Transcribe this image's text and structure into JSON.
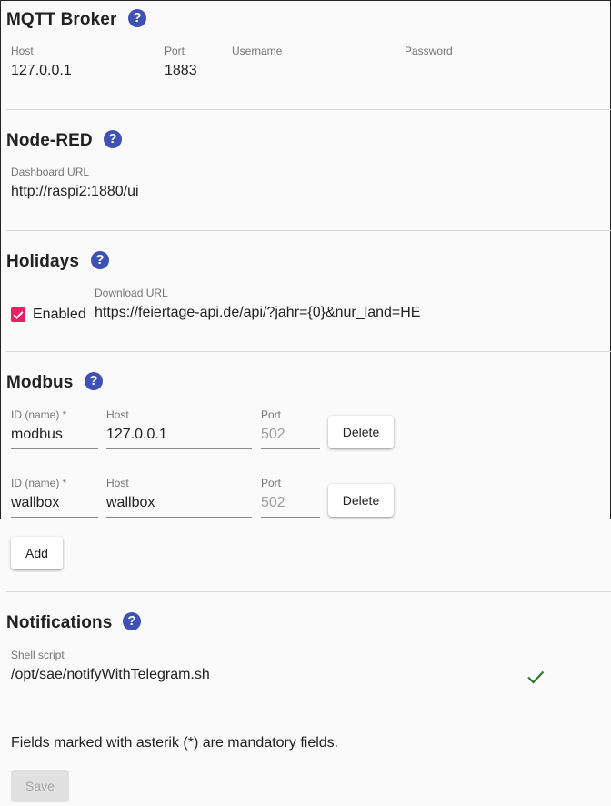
{
  "mqtt": {
    "title": "MQTT Broker",
    "host": {
      "label": "Host",
      "value": "127.0.0.1"
    },
    "port": {
      "label": "Port",
      "value": "1883"
    },
    "username": {
      "label": "Username",
      "value": ""
    },
    "password": {
      "label": "Password",
      "value": ""
    }
  },
  "nodered": {
    "title": "Node-RED",
    "dashboard_url": {
      "label": "Dashboard URL",
      "value": "http://raspi2:1880/ui"
    }
  },
  "holidays": {
    "title": "Holidays",
    "enabled_label": "Enabled",
    "enabled": true,
    "download_url": {
      "label": "Download URL",
      "value": "https://feiertage-api.de/api/?jahr={0}&nur_land=HE"
    }
  },
  "modbus": {
    "title": "Modbus",
    "id_label": "ID (name) *",
    "host_label": "Host",
    "port_label": "Port",
    "delete_label": "Delete",
    "add_label": "Add",
    "rows": [
      {
        "id": "modbus",
        "host": "127.0.0.1",
        "port": "502"
      },
      {
        "id": "wallbox",
        "host": "wallbox",
        "port": "502"
      }
    ]
  },
  "notifications": {
    "title": "Notifications",
    "shell_script": {
      "label": "Shell script",
      "value": "/opt/sae/notifyWithTelegram.sh"
    }
  },
  "footer": {
    "mandatory_note": "Fields marked with asterik (*) are mandatory fields.",
    "save_label": "Save"
  },
  "help_glyph": "?",
  "colors": {
    "help_icon": "#3f51b5",
    "checkbox": "#e91e63",
    "valid_check": "#2e7d32"
  }
}
